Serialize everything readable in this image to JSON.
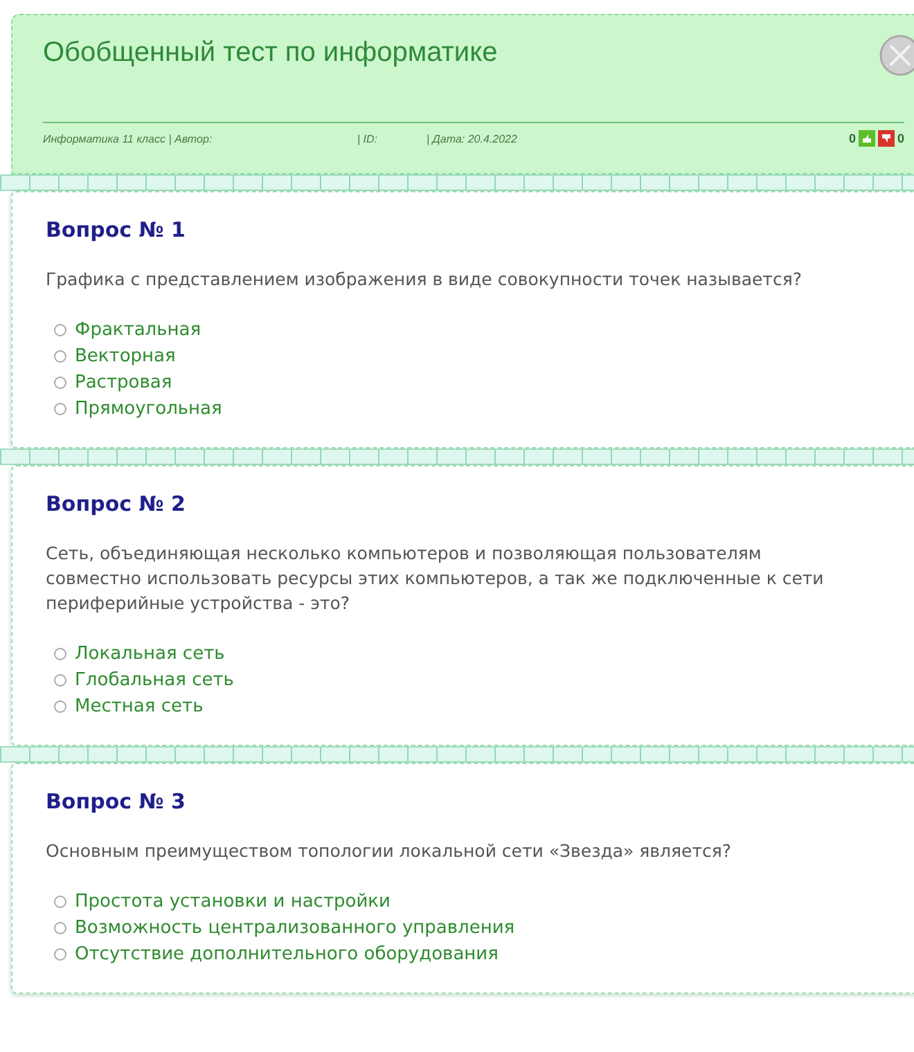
{
  "header": {
    "title": "Обобщенный тест по информатике",
    "meta": [
      "Информатика 11 класс | Автор:",
      "| ID:",
      "| Дата: 20.4.2022"
    ],
    "likes": "0",
    "dislikes": "0"
  },
  "questions": [
    {
      "heading": "Вопрос № 1",
      "text": "Графика с представлением изображения в виде совокупности точек называется?",
      "options": [
        {
          "label": "Фрактальная",
          "selected": false
        },
        {
          "label": "Векторная",
          "selected": false
        },
        {
          "label": "Растровая",
          "selected": false
        },
        {
          "label": "Прямоугольная",
          "selected": false
        }
      ]
    },
    {
      "heading": "Вопрос № 2",
      "text": "Сеть, объединяющая несколько компьютеров и позволяющая пользователям совместно использовать ресурсы этих компьютеров, а так же подключенные к сети периферийные устройства - это?",
      "options": [
        {
          "label": "Локальная сеть",
          "selected": false
        },
        {
          "label": "Глобальная сеть",
          "selected": false
        },
        {
          "label": "Местная сеть",
          "selected": false
        }
      ]
    },
    {
      "heading": "Вопрос № 3",
      "text": "Основным преимуществом топологии локальной сети «Звезда» является?",
      "options": [
        {
          "label": "Простота установки и настройки",
          "selected": false
        },
        {
          "label": "Возможность централизованного управления",
          "selected": false
        },
        {
          "label": "Отсутствие дополнительного оборудования",
          "selected": false
        }
      ]
    }
  ]
}
